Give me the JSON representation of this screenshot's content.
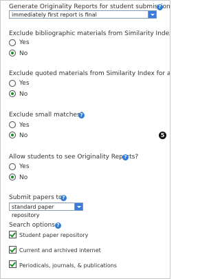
{
  "reports": {
    "question": "Generate Originality Reports for student submissions",
    "selected": "immediately first report is final"
  },
  "exclude_bib": {
    "question": "Exclude bibliographic materials from Similarity Index for all",
    "yes": "Yes",
    "no": "No",
    "value": "No"
  },
  "exclude_quoted": {
    "question": "Exclude quoted materials from Similarity Index for all paper",
    "yes": "Yes",
    "no": "No",
    "value": "No"
  },
  "exclude_small": {
    "question": "Exclude small matches?",
    "yes": "Yes",
    "no": "No",
    "value": "No",
    "annotation": "5"
  },
  "allow_students": {
    "question": "Allow students to see Originality Reports?",
    "yes": "Yes",
    "no": "No",
    "value": "No"
  },
  "submit_papers": {
    "question": "Submit papers to:",
    "selected": "standard paper repository"
  },
  "search_options": {
    "title": "Search options:",
    "items": [
      {
        "label": "Student paper repository",
        "checked": true
      },
      {
        "label": "Current and archived internet",
        "checked": true
      },
      {
        "label": "Periodicals, journals, & publications",
        "checked": true
      }
    ]
  },
  "icons": {
    "help": "question-mark-icon"
  },
  "colors": {
    "help_blue": "#2f7dd6",
    "radio_green": "#1a8f2a",
    "select_arrow": "#3b7be0"
  }
}
